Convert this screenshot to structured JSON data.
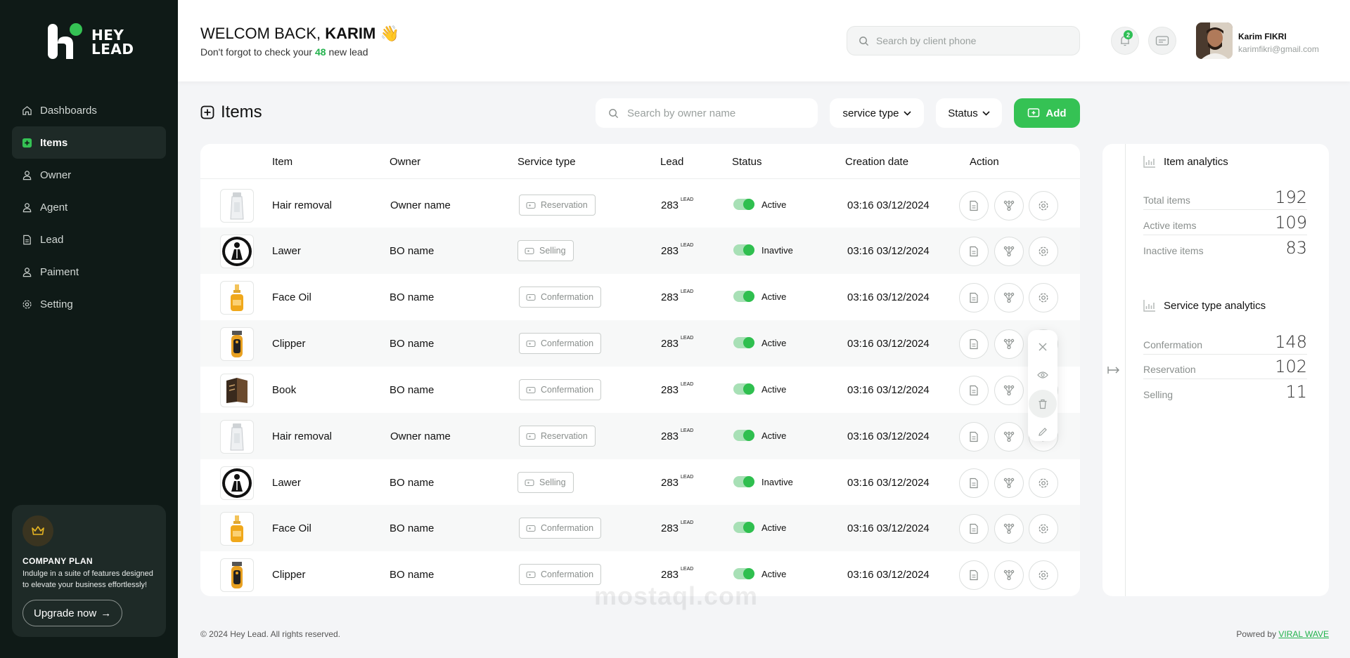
{
  "brand": {
    "line1": "HEY",
    "line2": "LEAD"
  },
  "sidebar": {
    "items": [
      {
        "label": "Dashboards",
        "icon": "home-icon"
      },
      {
        "label": "Items",
        "icon": "plus-square-icon",
        "active": true
      },
      {
        "label": "Owner",
        "icon": "user-icon"
      },
      {
        "label": "Agent",
        "icon": "user-icon"
      },
      {
        "label": "Lead",
        "icon": "document-icon"
      },
      {
        "label": "Paiment",
        "icon": "user-icon"
      },
      {
        "label": "Setting",
        "icon": "gear-icon"
      }
    ],
    "plan": {
      "title": "COMPANY  PLAN",
      "desc": "Indulge in a suite of features designed to elevate your business effortlessly!",
      "button": "Upgrade now"
    }
  },
  "header": {
    "welcome_prefix": "WELCOM BACK, ",
    "welcome_name": "KARIM",
    "welcome_emoji": "👋",
    "sub_prefix": "Don't forgot to check your ",
    "sub_count": "48",
    "sub_suffix": " new lead",
    "search_placeholder": "Search by client phone",
    "notif_count": "2",
    "user_name": "Karim FIKRI",
    "user_email": "karimfikri@gmail.com"
  },
  "page": {
    "title": "Items",
    "owner_search_placeholder": "Search by owner name",
    "service_type_label": "service type",
    "status_label": "Status",
    "add_label": "Add"
  },
  "table": {
    "columns": [
      "Item",
      "Owner",
      "Service type",
      "Lead",
      "Status",
      "Creation date",
      "Action"
    ],
    "lead_suffix": "LEAD",
    "rows": [
      {
        "item": "Hair removal",
        "owner": "Owner name",
        "service": "Reservation",
        "lead": "283",
        "status": "Active",
        "date": "03:16 03/12/2024",
        "thumb": "tube"
      },
      {
        "item": "Lawer",
        "owner": "BO name",
        "service": "Selling",
        "lead": "283",
        "status": "Inavtive",
        "date": "03:16 03/12/2024",
        "thumb": "lawyer"
      },
      {
        "item": "Face Oil",
        "owner": "BO name",
        "service": "Confermation",
        "lead": "283",
        "status": "Active",
        "date": "03:16 03/12/2024",
        "thumb": "bottle"
      },
      {
        "item": "Clipper",
        "owner": "BO name",
        "service": "Confermation",
        "lead": "283",
        "status": "Active",
        "date": "03:16 03/12/2024",
        "thumb": "clipper"
      },
      {
        "item": "Book",
        "owner": "BO name",
        "service": "Confermation",
        "lead": "283",
        "status": "Active",
        "date": "03:16 03/12/2024",
        "thumb": "book"
      },
      {
        "item": "Hair removal",
        "owner": "Owner name",
        "service": "Reservation",
        "lead": "283",
        "status": "Active",
        "date": "03:16 03/12/2024",
        "thumb": "tube"
      },
      {
        "item": "Lawer",
        "owner": "BO name",
        "service": "Selling",
        "lead": "283",
        "status": "Inavtive",
        "date": "03:16 03/12/2024",
        "thumb": "lawyer"
      },
      {
        "item": "Face Oil",
        "owner": "BO name",
        "service": "Confermation",
        "lead": "283",
        "status": "Active",
        "date": "03:16 03/12/2024",
        "thumb": "bottle"
      },
      {
        "item": "Clipper",
        "owner": "BO name",
        "service": "Confermation",
        "lead": "283",
        "status": "Active",
        "date": "03:16 03/12/2024",
        "thumb": "clipper"
      }
    ]
  },
  "analytics": {
    "item_title": "Item analytics",
    "item_stats": [
      {
        "label": "Total items",
        "value": "192"
      },
      {
        "label": "Active items",
        "value": "109"
      },
      {
        "label": "Inactive items",
        "value": "83"
      }
    ],
    "service_title": "Service type analytics",
    "service_stats": [
      {
        "label": "Confermation",
        "value": "148"
      },
      {
        "label": "Reservation",
        "value": "102"
      },
      {
        "label": "Selling",
        "value": "11"
      }
    ]
  },
  "footer": {
    "copyright": "© 2024 Hey Lead. All rights reserved.",
    "powered_prefix": "Powred by ",
    "powered_link": "VIRAL WAVE"
  },
  "watermark": "mostaql.com",
  "colors": {
    "accent": "#35c254",
    "sidebar_bg": "#0f1a17"
  }
}
